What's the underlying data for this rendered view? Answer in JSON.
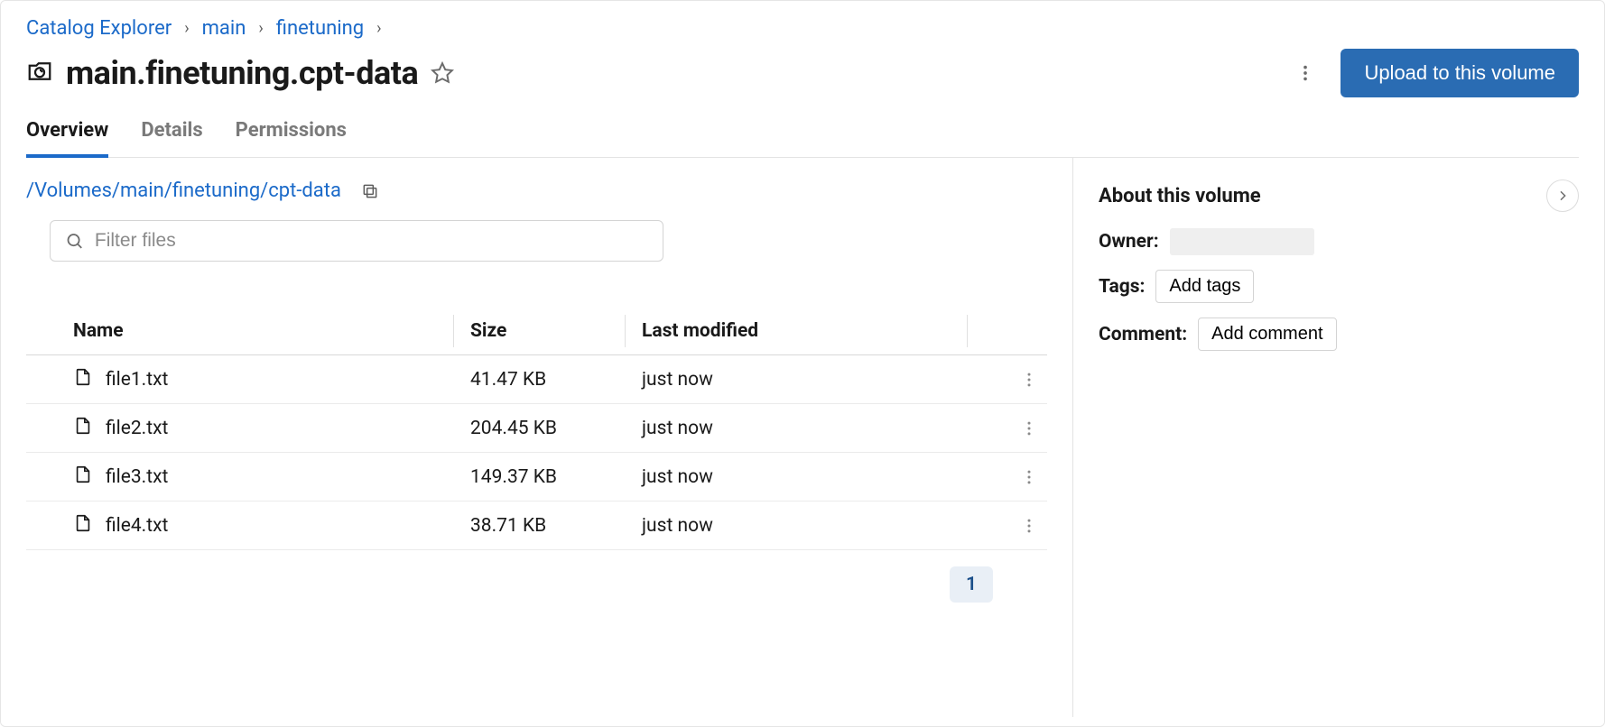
{
  "breadcrumb": {
    "root": "Catalog Explorer",
    "items": [
      "main",
      "finetuning"
    ]
  },
  "title": "main.finetuning.cpt-data",
  "actions": {
    "upload_label": "Upload to this volume"
  },
  "tabs": [
    {
      "label": "Overview",
      "active": true
    },
    {
      "label": "Details",
      "active": false
    },
    {
      "label": "Permissions",
      "active": false
    }
  ],
  "volume_path": "/Volumes/main/finetuning/cpt-data",
  "filter": {
    "placeholder": "Filter files"
  },
  "table": {
    "headers": {
      "name": "Name",
      "size": "Size",
      "modified": "Last modified"
    },
    "rows": [
      {
        "name": "file1.txt",
        "size": "41.47 KB",
        "modified": "just now"
      },
      {
        "name": "file2.txt",
        "size": "204.45 KB",
        "modified": "just now"
      },
      {
        "name": "file3.txt",
        "size": "149.37 KB",
        "modified": "just now"
      },
      {
        "name": "file4.txt",
        "size": "38.71 KB",
        "modified": "just now"
      }
    ]
  },
  "pagination": {
    "current": "1"
  },
  "about": {
    "heading": "About this volume",
    "owner_label": "Owner:",
    "tags_label": "Tags:",
    "add_tags": "Add tags",
    "comment_label": "Comment:",
    "add_comment": "Add comment"
  }
}
